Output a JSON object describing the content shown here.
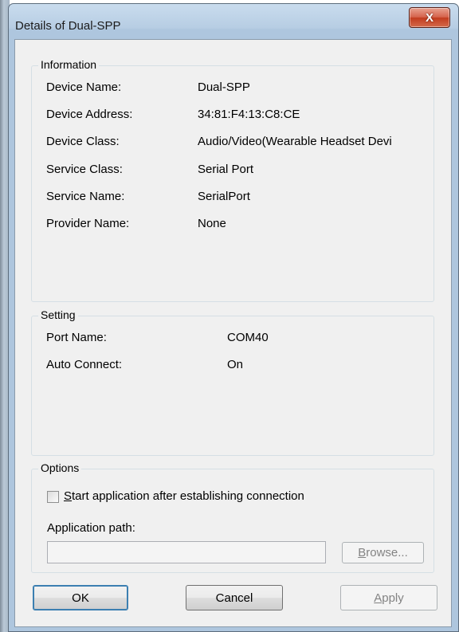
{
  "window": {
    "title": "Details of Dual-SPP",
    "close_label": "X"
  },
  "information": {
    "label": "Information",
    "rows": [
      {
        "key": "Device Name:",
        "value": "Dual-SPP"
      },
      {
        "key": "Device Address:",
        "value": "34:81:F4:13:C8:CE"
      },
      {
        "key": "Device Class:",
        "value": "Audio/Video(Wearable Headset Devi"
      },
      {
        "key": "Service Class:",
        "value": "Serial Port"
      },
      {
        "key": "Service Name:",
        "value": "SerialPort"
      },
      {
        "key": "Provider Name:",
        "value": "None"
      }
    ]
  },
  "setting": {
    "label": "Setting",
    "rows": [
      {
        "key": "Port Name:",
        "value": "COM40"
      },
      {
        "key": "Auto Connect:",
        "value": "On"
      }
    ]
  },
  "options": {
    "label": "Options",
    "checkbox_hotkey": "S",
    "checkbox_label_rest": "tart application after establishing connection",
    "checkbox_checked": false,
    "path_label": "Application path:",
    "path_value": "",
    "browse_hotkey": "B",
    "browse_rest": "rowse..."
  },
  "buttons": {
    "ok": "OK",
    "cancel": "Cancel",
    "apply_hotkey": "A",
    "apply_rest": "pply"
  }
}
